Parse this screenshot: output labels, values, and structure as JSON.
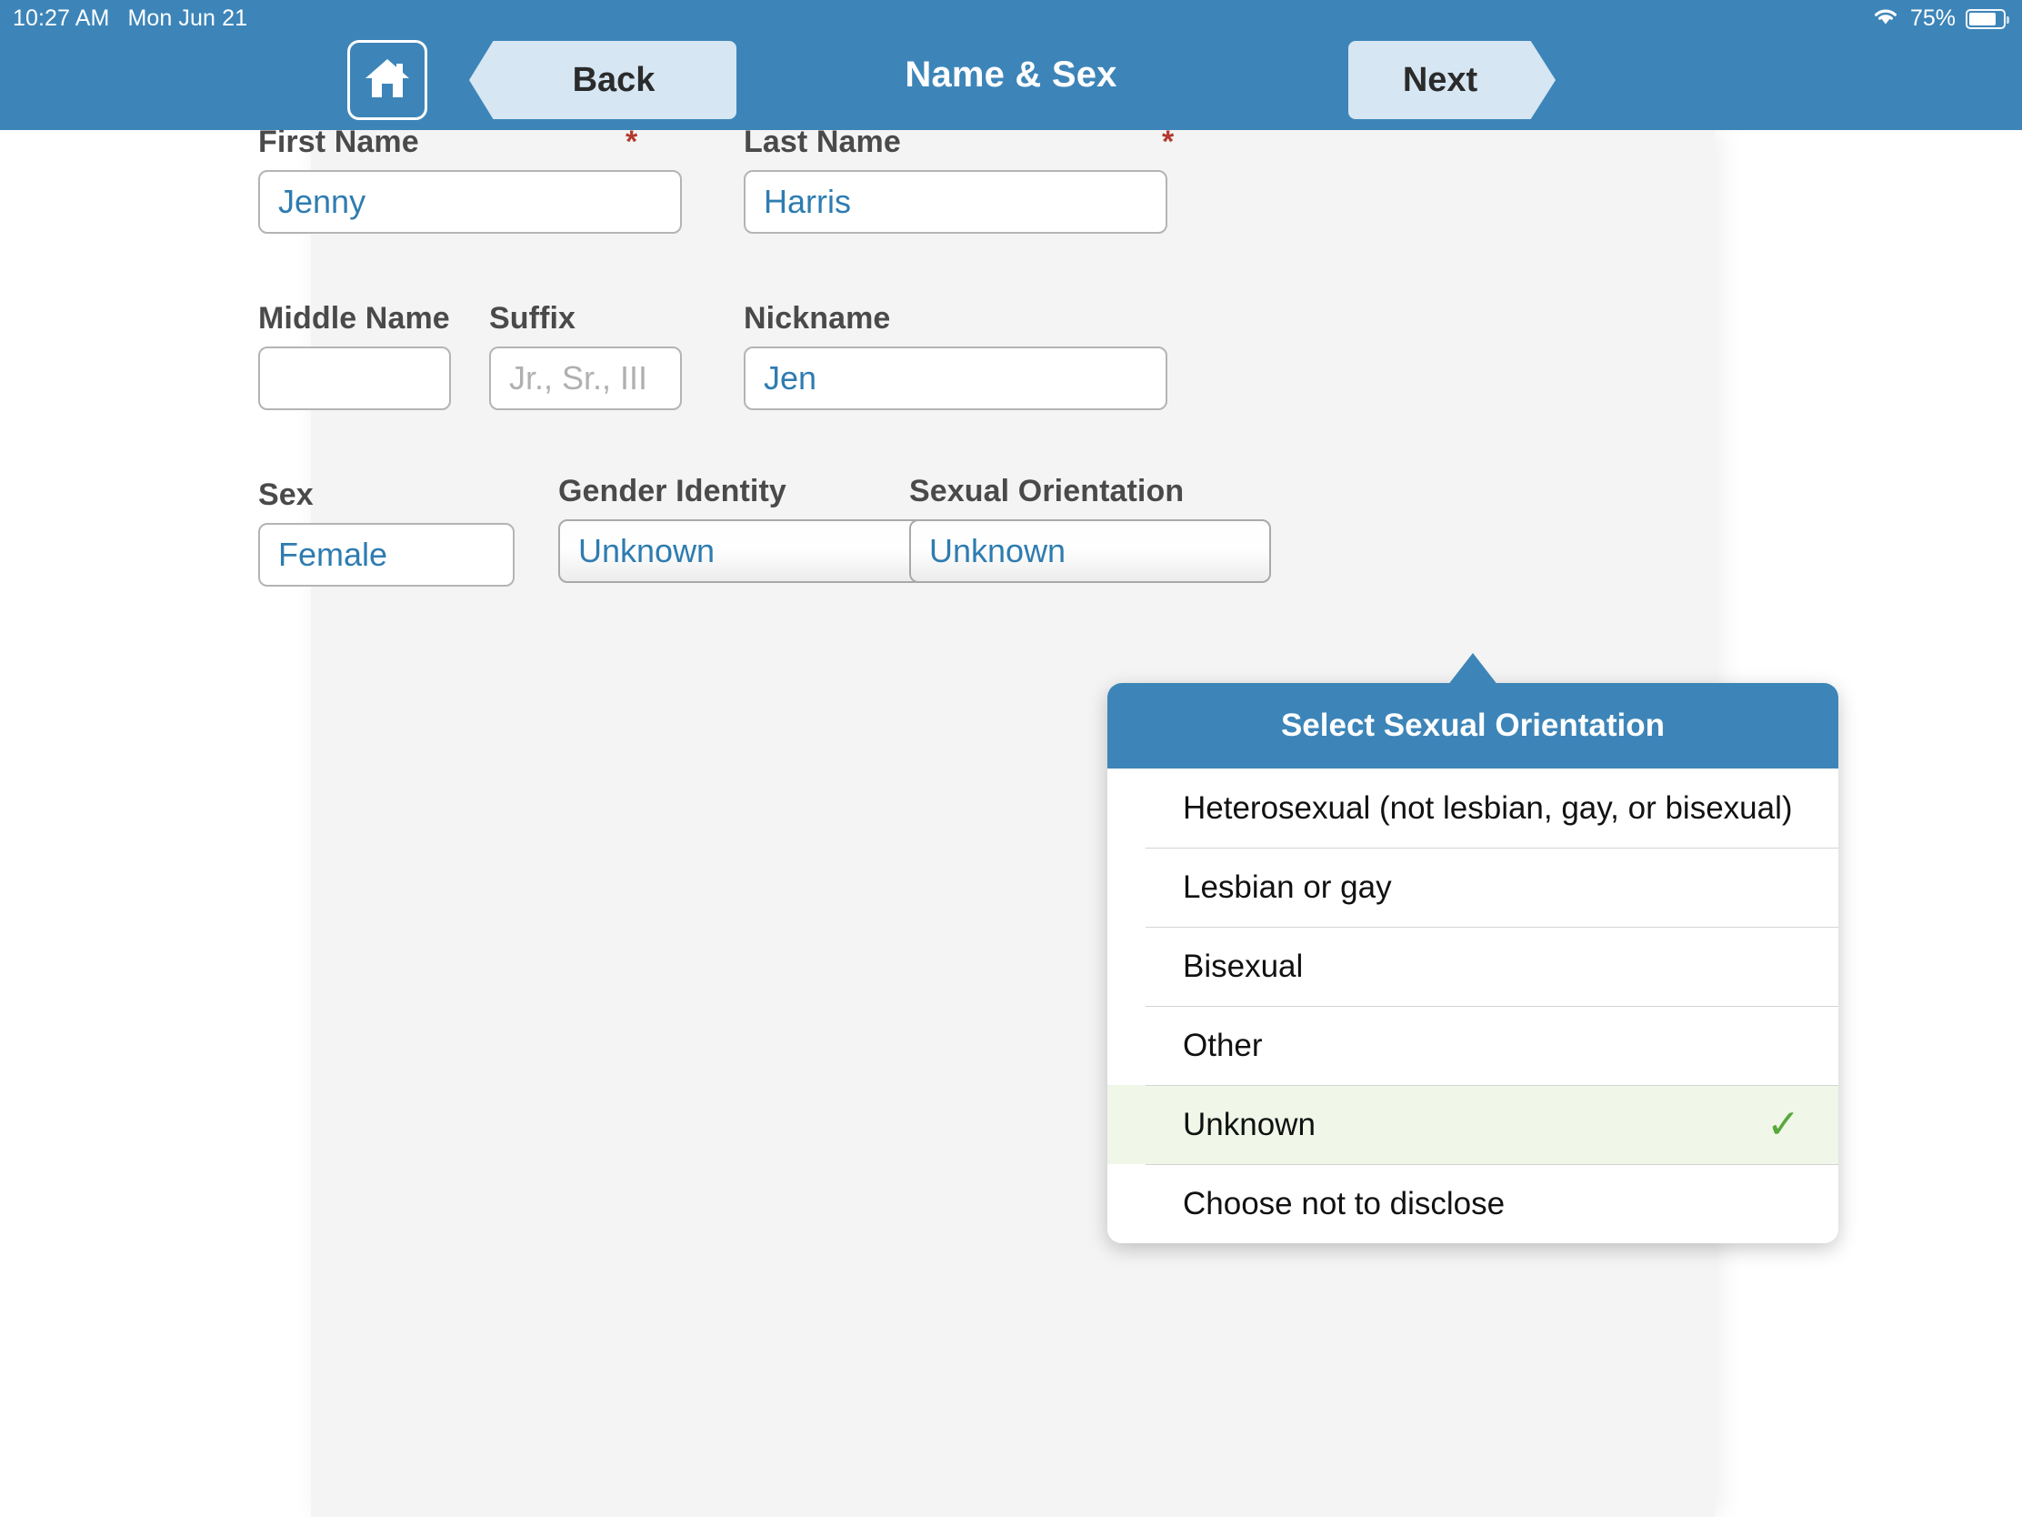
{
  "status_bar": {
    "time": "10:27 AM",
    "date": "Mon Jun 21",
    "wifi_icon": "wifi-icon",
    "battery_percent": "75%",
    "battery_icon": "battery-icon"
  },
  "nav": {
    "home_icon": "home-icon",
    "back_label": "Back",
    "title": "Name & Sex",
    "next_label": "Next"
  },
  "form": {
    "first_name": {
      "label": "First Name",
      "required_marker": "*",
      "value": "Jenny",
      "placeholder": ""
    },
    "last_name": {
      "label": "Last Name",
      "required_marker": "*",
      "value": "Harris",
      "placeholder": ""
    },
    "middle_name": {
      "label": "Middle Name",
      "value": "",
      "placeholder": ""
    },
    "suffix": {
      "label": "Suffix",
      "value": "",
      "placeholder": "Jr., Sr., III"
    },
    "nickname": {
      "label": "Nickname",
      "value": "Jen",
      "placeholder": ""
    },
    "sex": {
      "label": "Sex",
      "value": "Female"
    },
    "gender_identity": {
      "label": "Gender Identity",
      "value": "Unknown"
    },
    "sexual_orientation": {
      "label": "Sexual Orientation",
      "value": "Unknown"
    }
  },
  "popover": {
    "title": "Select Sexual Orientation",
    "check_icon": "check-icon",
    "items": [
      {
        "label": "Heterosexual (not lesbian, gay, or bisexual)",
        "selected": false
      },
      {
        "label": "Lesbian or gay",
        "selected": false
      },
      {
        "label": "Bisexual",
        "selected": false
      },
      {
        "label": "Other",
        "selected": false
      },
      {
        "label": "Unknown",
        "selected": true
      },
      {
        "label": "Choose not to disclose",
        "selected": false
      }
    ]
  },
  "colors": {
    "accent": "#3d85b8",
    "button": "#d6e6f2",
    "value_text": "#2e7cb0",
    "required": "#b5392f",
    "selected_row": "#f0f7e8",
    "check": "#59a83b",
    "panel": "#f4f4f4"
  }
}
